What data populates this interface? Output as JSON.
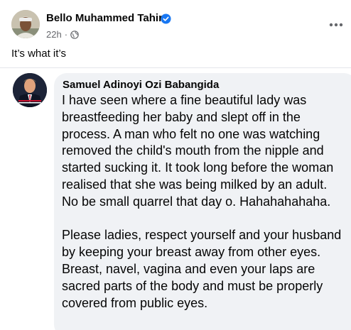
{
  "post": {
    "author": "Bello Muhammed Tahir",
    "timestamp": "22h",
    "separator": "·",
    "caption": "It’s what it’s"
  },
  "quoted": {
    "author": "Samuel Adinoyi Ozi Babangida",
    "paragraphs": [
      "I have seen where a fine beautiful lady was breastfeeding her baby and slept off in the process. A man who felt no one was watching removed the child's mouth from the nipple and started sucking it. It took long before the woman realised that she was being milked by an adult.  No be small quarrel that day o. Hahahahahaha.",
      "Please ladies, respect yourself and your husband by keeping your breast away from other eyes. Breast, navel, vagina and even your laps are sacred parts of the body and must be properly covered from public eyes."
    ]
  },
  "icons": {
    "verified": "verified-badge-icon",
    "audience": "globe-icon",
    "more": "more-options-icon"
  },
  "colors": {
    "verified": "#1877f2",
    "secondary_text": "#65676b",
    "bubble": "#f0f2f5"
  }
}
